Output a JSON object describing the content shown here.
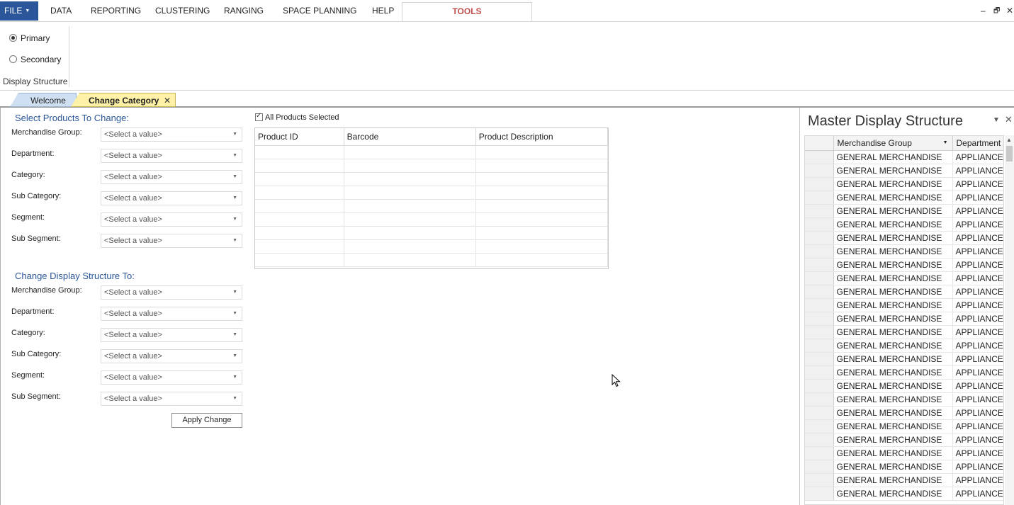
{
  "menubar": {
    "file_label": "FILE",
    "items": [
      "DATA",
      "REPORTING",
      "CLUSTERING",
      "RANGING",
      "SPACE PLANNING",
      "HELP"
    ],
    "tools_label": "TOOLS",
    "window_controls": {
      "minimize": "–",
      "restore": "🗗",
      "close": "✕"
    }
  },
  "ribbon": {
    "radio_primary": "Primary",
    "radio_secondary": "Secondary",
    "selected": "Primary",
    "group_label": "Display Structure"
  },
  "doc_tabs": {
    "welcome": "Welcome",
    "change": "Change Category",
    "close_glyph": "✕"
  },
  "select_products": {
    "title": "Select Products To Change:",
    "fields": [
      {
        "label": "Merchandise Group:",
        "value": "<Select a value>"
      },
      {
        "label": "Department:",
        "value": "<Select a value>"
      },
      {
        "label": "Category:",
        "value": "<Select a value>"
      },
      {
        "label": "Sub Category:",
        "value": "<Select a value>"
      },
      {
        "label": "Segment:",
        "value": "<Select a value>"
      },
      {
        "label": "Sub Segment:",
        "value": "<Select a value>"
      }
    ]
  },
  "change_structure": {
    "title": "Change Display Structure To:",
    "fields": [
      {
        "label": "Merchandise Group:",
        "value": "<Select a value>"
      },
      {
        "label": "Department:",
        "value": "<Select a value>"
      },
      {
        "label": "Category:",
        "value": "<Select a value>"
      },
      {
        "label": "Sub Category:",
        "value": "<Select a value>"
      },
      {
        "label": "Segment:",
        "value": "<Select a value>"
      },
      {
        "label": "Sub Segment:",
        "value": "<Select a value>"
      }
    ],
    "apply_label": "Apply Change"
  },
  "products": {
    "all_selected_label": "All Products Selected",
    "all_selected": true,
    "columns": [
      "Product ID",
      "Barcode",
      "Product Description"
    ]
  },
  "master": {
    "title": "Master Display Structure",
    "pin_glyph": "▼",
    "close_glyph": "✕",
    "columns": [
      "Merchandise Group",
      "Department"
    ],
    "rows": [
      [
        "GENERAL MERCHANDISE",
        "APPLIANCES"
      ],
      [
        "GENERAL MERCHANDISE",
        "APPLIANCES"
      ],
      [
        "GENERAL MERCHANDISE",
        "APPLIANCES"
      ],
      [
        "GENERAL MERCHANDISE",
        "APPLIANCES"
      ],
      [
        "GENERAL MERCHANDISE",
        "APPLIANCES"
      ],
      [
        "GENERAL MERCHANDISE",
        "APPLIANCES"
      ],
      [
        "GENERAL MERCHANDISE",
        "APPLIANCES"
      ],
      [
        "GENERAL MERCHANDISE",
        "APPLIANCES"
      ],
      [
        "GENERAL MERCHANDISE",
        "APPLIANCES"
      ],
      [
        "GENERAL MERCHANDISE",
        "APPLIANCES"
      ],
      [
        "GENERAL MERCHANDISE",
        "APPLIANCES"
      ],
      [
        "GENERAL MERCHANDISE",
        "APPLIANCES"
      ],
      [
        "GENERAL MERCHANDISE",
        "APPLIANCES"
      ],
      [
        "GENERAL MERCHANDISE",
        "APPLIANCES"
      ],
      [
        "GENERAL MERCHANDISE",
        "APPLIANCES"
      ],
      [
        "GENERAL MERCHANDISE",
        "APPLIANCES"
      ],
      [
        "GENERAL MERCHANDISE",
        "APPLIANCES"
      ],
      [
        "GENERAL MERCHANDISE",
        "APPLIANCES"
      ],
      [
        "GENERAL MERCHANDISE",
        "APPLIANCES"
      ],
      [
        "GENERAL MERCHANDISE",
        "APPLIANCES"
      ],
      [
        "GENERAL MERCHANDISE",
        "APPLIANCES"
      ],
      [
        "GENERAL MERCHANDISE",
        "APPLIANCES"
      ],
      [
        "GENERAL MERCHANDISE",
        "APPLIANCES"
      ],
      [
        "GENERAL MERCHANDISE",
        "APPLIANCES"
      ],
      [
        "GENERAL MERCHANDISE",
        "APPLIANCES"
      ],
      [
        "GENERAL MERCHANDISE",
        "APPLIANCES"
      ]
    ]
  }
}
